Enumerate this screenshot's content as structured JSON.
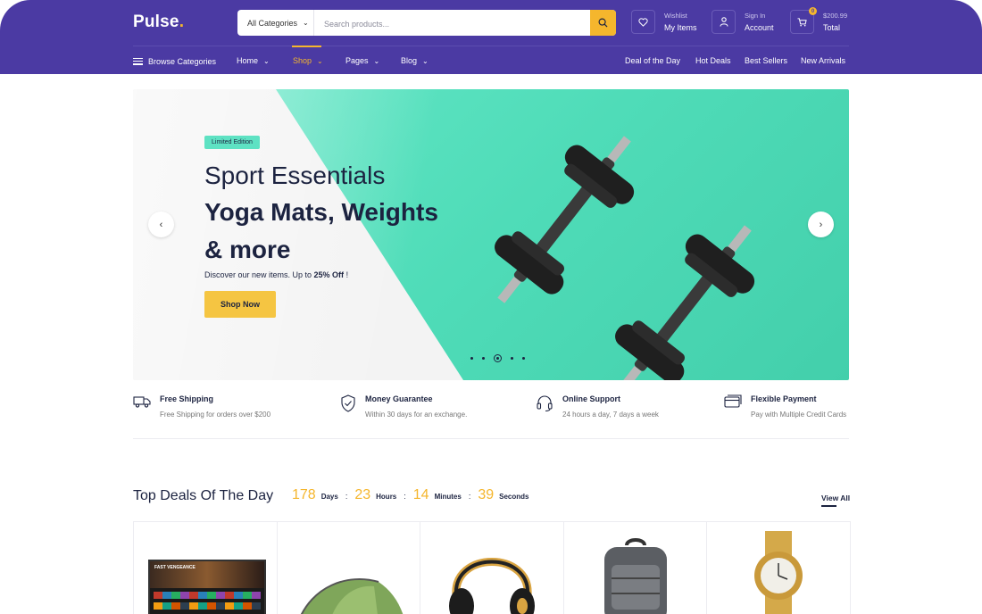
{
  "header": {
    "logo": "Pulse",
    "logo_dot": ".",
    "search": {
      "category": "All Categories",
      "placeholder": "Search products..."
    },
    "wishlist": {
      "small": "Wishlist",
      "big": "My Items"
    },
    "account": {
      "small": "Sign In",
      "big": "Account"
    },
    "cart": {
      "count": "0",
      "amount": "$200.99",
      "label": "Total"
    }
  },
  "nav": {
    "browse": "Browse Categories",
    "items": [
      "Home",
      "Shop",
      "Pages",
      "Blog"
    ],
    "right": [
      "Deal of the Day",
      "Hot Deals",
      "Best Sellers",
      "New Arrivals"
    ]
  },
  "hero": {
    "badge": "Limited Edition",
    "line1": "Sport Essentials",
    "line2": "Yoga Mats, Weights",
    "line3": "& more",
    "desc_prefix": "Discover our new items. Up to ",
    "desc_bold": "25% Off",
    "desc_suffix": " !",
    "cta": "Shop Now"
  },
  "features": [
    {
      "title": "Free Shipping",
      "desc": "Free Shipping for orders over $200"
    },
    {
      "title": "Money Guarantee",
      "desc": "Within 30 days for an exchange."
    },
    {
      "title": "Online Support",
      "desc": "24 hours a day, 7 days a week"
    },
    {
      "title": "Flexible Payment",
      "desc": "Pay with Multiple Credit Cards"
    }
  ],
  "deals": {
    "title": "Top Deals Of The Day",
    "days": "178",
    "days_label": "Days",
    "hours": "23",
    "hours_label": "Hours",
    "minutes": "14",
    "minutes_label": "Minutes",
    "seconds": "39",
    "seconds_label": "Seconds",
    "sep": ":",
    "view_all": "View All",
    "tv_caption": "FAST VENGEANCE"
  },
  "colors": {
    "header": "#4b3aa3",
    "accent": "#f5b62d",
    "hero_teal": "#4fdcb8",
    "text": "#1c2340"
  }
}
